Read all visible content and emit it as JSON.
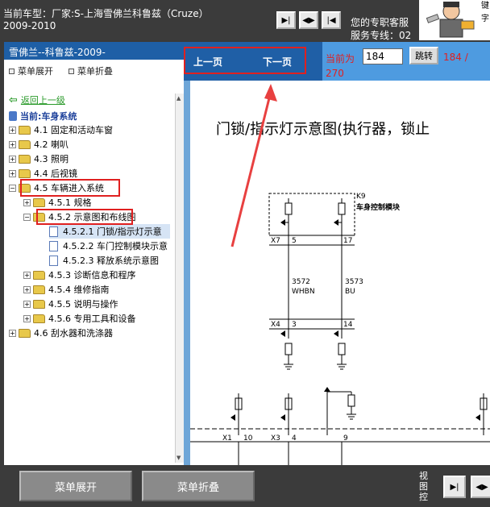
{
  "header": {
    "car_line1": "当前车型：厂家:S-上海雪佛兰科鲁兹（Cruze）",
    "car_line2": "2009-2010",
    "service_line1": "您的专职客服",
    "service_line2": "服务专线：02",
    "key_side": "键字"
  },
  "left": {
    "title": "雪佛兰--科鲁兹-2009-",
    "expand_label": "菜单展开",
    "collapse_label": "菜单折叠",
    "back_label": "返回上一级",
    "current_label": "当前:车身系统",
    "tree": [
      {
        "label": "4.1 固定和活动车窗"
      },
      {
        "label": "4.2 喇叭"
      },
      {
        "label": "4.3 照明"
      },
      {
        "label": "4.4 后视镜"
      },
      {
        "label": "4.5 车辆进入系统"
      },
      {
        "label": "4.5.1 规格"
      },
      {
        "label": "4.5.2 示意图和布线图"
      },
      {
        "label": "4.5.2.1 门锁/指示灯示意"
      },
      {
        "label": "4.5.2.2 车门控制模块示意"
      },
      {
        "label": "4.5.2.3 释放系统示意图"
      },
      {
        "label": "4.5.3 诊断信息和程序"
      },
      {
        "label": "4.5.4 维修指南"
      },
      {
        "label": "4.5.5 说明与操作"
      },
      {
        "label": "4.5.6 专用工具和设备"
      },
      {
        "label": "4.6 刮水器和洗涤器"
      }
    ]
  },
  "pagenav": {
    "prev": "上一页",
    "next": "下一页",
    "current_prefix": "当前为",
    "page_value": "184",
    "jump": "跳转",
    "total_a": "184 /",
    "total_b": "270"
  },
  "diagram": {
    "title": "门锁/指示灯示意图(执行器，锁止",
    "k9": "K9",
    "module": "车身控制模块",
    "x7": "X7",
    "pin5": "5",
    "pin17": "17",
    "w1_code": "3572",
    "w1_color": "WHBN",
    "w2_code": "3573",
    "w2_color": "BU",
    "x4": "X4",
    "pin3": "3",
    "pin14": "14",
    "x1": "X1",
    "pin10": "10",
    "x3": "X3",
    "pin4": "4",
    "pin9": "9"
  },
  "bottom": {
    "expand": "菜单展开",
    "collapse": "菜单折叠",
    "view_label": "视图控"
  },
  "colors": {
    "highlight": "#e02020",
    "header_blue": "#1f5fa6",
    "nav_blue": "#4e9be0"
  }
}
